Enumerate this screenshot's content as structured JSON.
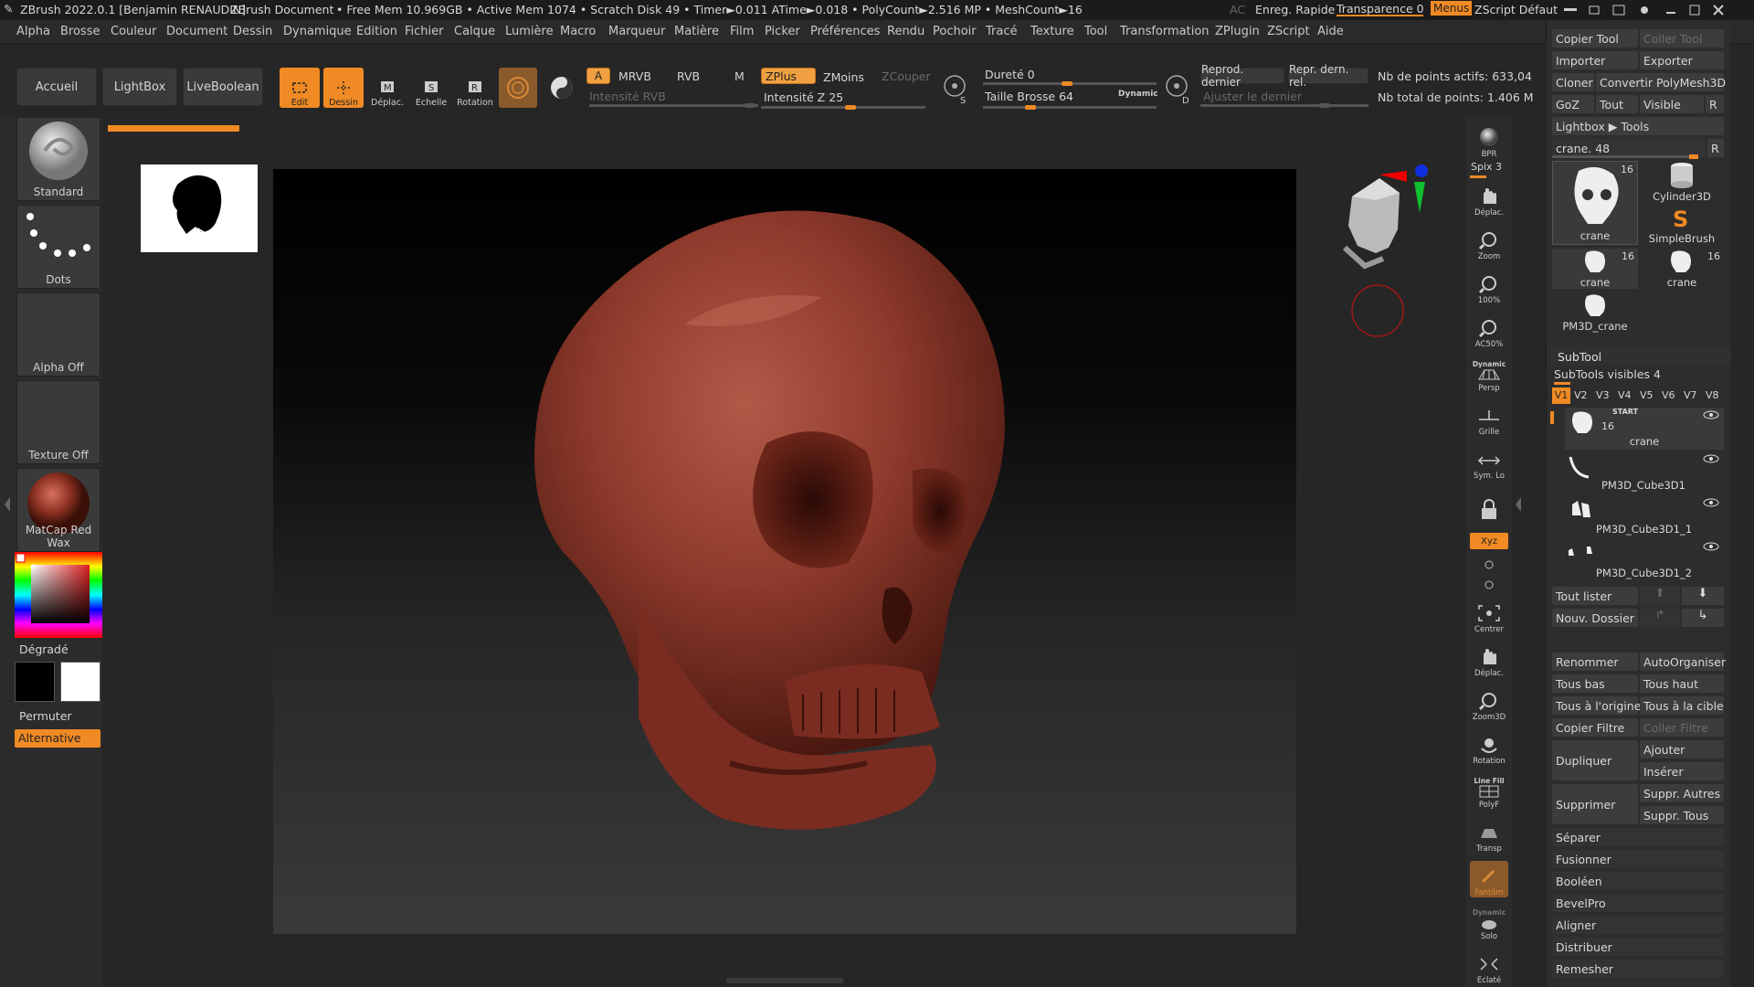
{
  "titlebar": {
    "app": "ZBrush 2022.0.1 [Benjamin RENAUDIN]",
    "doc": "ZBrush Document",
    "stats": "• Free Mem 10.969GB • Active Mem 1074 • Scratch Disk 49 • Timer►0.011 ATime►0.018 • PolyCount►2.516 MP • MeshCount►16",
    "ac": "AC",
    "quicksave": "Enreg. Rapide",
    "transparency": "Transparence 0",
    "menus": "Menus",
    "zscript": "ZScript Défaut"
  },
  "menubar": [
    "Alpha",
    "Brosse",
    "Couleur",
    "Document",
    "Dessin",
    "Dynamique",
    "Edition",
    "Fichier",
    "Calque",
    "Lumière",
    "Macro",
    "Marqueur",
    "Matière",
    "Film",
    "Picker",
    "Préférences",
    "Rendu",
    "Pochoir",
    "Tracé",
    "Texture",
    "Tool",
    "Transformation",
    "ZPlugin",
    "ZScript",
    "Aide"
  ],
  "topshelf": {
    "home": "Accueil",
    "lightbox": "LightBox",
    "liveboolean": "LiveBoolean",
    "edit": "Edit",
    "draw": "Dessin",
    "move": "Déplac.",
    "scale": "Echelle",
    "rotate": "Rotation",
    "a": "A",
    "mrgb": "MRVB",
    "rgb": "RVB",
    "m": "M",
    "rgb_intensity": "Intensité RVB",
    "zadd": "ZPlus",
    "zsub": "ZMoins",
    "zcut": "ZCouper",
    "z_intensity": "Intensité Z 25",
    "z_intensity_value": 25,
    "hardness": "Dureté 0",
    "brush_size": "Taille Brosse 64",
    "dynamic": "Dynamic",
    "s": "S",
    "d": "D",
    "replay_last": "Reprod. dernier",
    "replay_last_rel": "Repr. dern. rel.",
    "adjust_last": "Ajuster le dernier",
    "active_points": "Nb de points actifs: 633,04",
    "total_points": "Nb total de points: 1.406 M"
  },
  "leftshelf": {
    "brush": "Standard",
    "stroke": "Dots",
    "alpha": "Alpha Off",
    "texture": "Texture Off",
    "material": "MatCap Red Wax",
    "gradient": "Dégradé",
    "switch": "Permuter",
    "alternate": "Alternative"
  },
  "rightshelf": {
    "bpr": "BPR",
    "spix": "Spix 3",
    "move": "Déplac.",
    "zoom": "Zoom",
    "actual": "100%",
    "aahalf": "AC50%",
    "persp_top": "Dynamic",
    "persp": "Persp",
    "floor": "Grille",
    "local": "Sym. Lo",
    "lock": "",
    "xyz": "Xyz",
    "frame": "Centrer",
    "move3d": "Déplac.",
    "zoom3d": "Zoom3D",
    "rotate3d": "Rotation",
    "linefill_top": "Line Fill",
    "polyf": "PolyF",
    "transp": "Transp",
    "ghost": "Fantôm",
    "solo_top": "Dynamic",
    "solo": "Solo",
    "xpose": "Eclaté"
  },
  "panel": {
    "copy_tool": "Copier Tool",
    "paste_tool": "Coller Tool",
    "import": "Importer",
    "export": "Exporter",
    "clone": "Cloner",
    "make_polymesh": "Convertir PolyMesh3D",
    "goz": "GoZ",
    "all": "Tout",
    "visible": "Visible",
    "r": "R",
    "lightbox_tools": "Lightbox ▶ Tools",
    "tool_slider": "crane. 48",
    "tools": [
      {
        "name": "crane",
        "count": "16"
      },
      {
        "name": "Cylinder3D",
        "count": ""
      },
      {
        "name": "SimpleBrush",
        "count": ""
      },
      {
        "name": "crane",
        "count": "16"
      },
      {
        "name": "crane",
        "count": "16"
      },
      {
        "name": "PM3D_crane",
        "count": ""
      }
    ],
    "subtool_title": "SubTool",
    "subtools_visible": "SubTools visibles 4",
    "versions": [
      "V1",
      "V2",
      "V3",
      "V4",
      "V5",
      "V6",
      "V7",
      "V8"
    ],
    "subtools": [
      {
        "name": "crane",
        "count": "16",
        "tag": "START"
      },
      {
        "name": "PM3D_Cube3D1",
        "count": "",
        "tag": ""
      },
      {
        "name": "PM3D_Cube3D1_1",
        "count": "",
        "tag": ""
      },
      {
        "name": "PM3D_Cube3D1_2",
        "count": "",
        "tag": ""
      }
    ],
    "list_all": "Tout lister",
    "new_folder": "Nouv. Dossier",
    "rename": "Renommer",
    "autoreorder": "AutoOrganiser",
    "all_low": "Tous bas",
    "all_high": "Tous haut",
    "all_to_home": "Tous à l'origine",
    "all_to_target": "Tous à la cible",
    "copy_filter": "Copier Filtre",
    "paste_filter": "Coller Filtre",
    "duplicate": "Dupliquer",
    "append": "Ajouter",
    "insert": "Insérer",
    "delete": "Supprimer",
    "del_other": "Suppr. Autres",
    "del_all": "Suppr. Tous",
    "split": "Séparer",
    "merge": "Fusionner",
    "boolean": "Booléen",
    "bevelpro": "BevelPro",
    "align": "Aligner",
    "distribute": "Distribuer",
    "remesh": "Remesher"
  },
  "colors": {
    "accent": "#f08a24",
    "panel": "#2d2d2d",
    "skull": "#8e3a2c"
  }
}
